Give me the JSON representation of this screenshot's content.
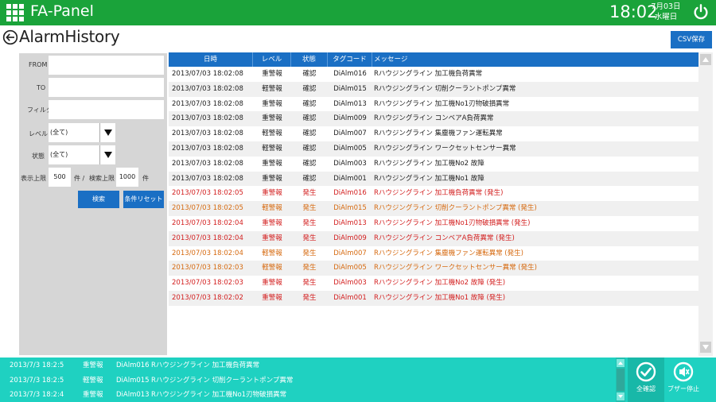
{
  "topbar": {
    "title": "FA-Panel",
    "time": "18:02",
    "date": "7月03日",
    "weekday": "水曜日",
    "apps_icon": "grid-icon",
    "power_icon": "power-icon",
    "bg_color": "#1aa33a"
  },
  "header": {
    "title": "AlarmHistory",
    "back_icon": "back-arrow-icon",
    "csv_label": "CSV保存"
  },
  "filter": {
    "from_label": "FROM",
    "to_label": "TO",
    "filter_label": "フィルタ",
    "level_label": "レベル",
    "level_value": "(全て)",
    "state_label": "状態",
    "state_value": "(全て)",
    "display_limit_label": "表示上限",
    "display_limit_value": "500",
    "unit1": "件 /",
    "search_limit_label": "検索上限",
    "search_limit_value": "1000",
    "unit2": "件",
    "search_button": "検索",
    "reset_button": "条件リセット"
  },
  "table": {
    "columns": [
      "日時",
      "レベル",
      "状態",
      "タグコード",
      "メッセージ"
    ],
    "rows": [
      {
        "time": "2013/07/03 18:02:08",
        "level": "重警報",
        "state": "確認",
        "tag": "DiAlm016",
        "msg": "Rハウジングライン  加工機負荷異常",
        "tone": "ok"
      },
      {
        "time": "2013/07/03 18:02:08",
        "level": "軽警報",
        "state": "確認",
        "tag": "DiAlm015",
        "msg": "Rハウジングライン  切削クーラントポンプ異常",
        "tone": "ok"
      },
      {
        "time": "2013/07/03 18:02:08",
        "level": "重警報",
        "state": "確認",
        "tag": "DiAlm013",
        "msg": "Rハウジングライン  加工機No1刃物破損異常",
        "tone": "ok"
      },
      {
        "time": "2013/07/03 18:02:08",
        "level": "重警報",
        "state": "確認",
        "tag": "DiAlm009",
        "msg": "Rハウジングライン  コンベアA負荷異常",
        "tone": "ok"
      },
      {
        "time": "2013/07/03 18:02:08",
        "level": "軽警報",
        "state": "確認",
        "tag": "DiAlm007",
        "msg": "Rハウジングライン  集塵機ファン運転異常",
        "tone": "ok"
      },
      {
        "time": "2013/07/03 18:02:08",
        "level": "軽警報",
        "state": "確認",
        "tag": "DiAlm005",
        "msg": "Rハウジングライン  ワークセットセンサー異常",
        "tone": "ok"
      },
      {
        "time": "2013/07/03 18:02:08",
        "level": "重警報",
        "state": "確認",
        "tag": "DiAlm003",
        "msg": "Rハウジングライン  加工機No2  故障",
        "tone": "ok"
      },
      {
        "time": "2013/07/03 18:02:08",
        "level": "重警報",
        "state": "確認",
        "tag": "DiAlm001",
        "msg": "Rハウジングライン  加工機No1  故障",
        "tone": "ok"
      },
      {
        "time": "2013/07/03 18:02:05",
        "level": "重警報",
        "state": "発生",
        "tag": "DiAlm016",
        "msg": "Rハウジングライン  加工機負荷異常 (発生)",
        "tone": "red"
      },
      {
        "time": "2013/07/03 18:02:05",
        "level": "軽警報",
        "state": "発生",
        "tag": "DiAlm015",
        "msg": "Rハウジングライン  切削クーラントポンプ異常 (発生)",
        "tone": "orange"
      },
      {
        "time": "2013/07/03 18:02:04",
        "level": "重警報",
        "state": "発生",
        "tag": "DiAlm013",
        "msg": "Rハウジングライン  加工機No1刃物破損異常 (発生)",
        "tone": "red"
      },
      {
        "time": "2013/07/03 18:02:04",
        "level": "重警報",
        "state": "発生",
        "tag": "DiAlm009",
        "msg": "Rハウジングライン  コンベアA負荷異常 (発生)",
        "tone": "red"
      },
      {
        "time": "2013/07/03 18:02:04",
        "level": "軽警報",
        "state": "発生",
        "tag": "DiAlm007",
        "msg": "Rハウジングライン  集塵機ファン運転異常 (発生)",
        "tone": "orange"
      },
      {
        "time": "2013/07/03 18:02:03",
        "level": "軽警報",
        "state": "発生",
        "tag": "DiAlm005",
        "msg": "Rハウジングライン  ワークセットセンサー異常 (発生)",
        "tone": "orange"
      },
      {
        "time": "2013/07/03 18:02:03",
        "level": "重警報",
        "state": "発生",
        "tag": "DiAlm003",
        "msg": "Rハウジングライン  加工機No2  故障 (発生)",
        "tone": "red"
      },
      {
        "time": "2013/07/03 18:02:02",
        "level": "重警報",
        "state": "発生",
        "tag": "DiAlm001",
        "msg": "Rハウジングライン  加工機No1  故障 (発生)",
        "tone": "red"
      }
    ]
  },
  "bottom": {
    "alarms": [
      {
        "time": "2013/7/3 18:2:5",
        "level": "重警報",
        "tag": "DiAlm016",
        "msg": "Rハウジングライン  加工機負荷異常"
      },
      {
        "time": "2013/7/3 18:2:5",
        "level": "軽警報",
        "tag": "DiAlm015",
        "msg": "Rハウジングライン  切削クーラントポンプ異常"
      },
      {
        "time": "2013/7/3 18:2:4",
        "level": "重警報",
        "tag": "DiAlm013",
        "msg": "Rハウジングライン  加工機No1刃物破損異常"
      }
    ],
    "ack_label": "全確認",
    "buzzer_label": "ブザー停止",
    "ack_icon": "check-circle-icon",
    "buzzer_icon": "buzzer-mute-icon",
    "bg_color": "#1fd1c1"
  }
}
